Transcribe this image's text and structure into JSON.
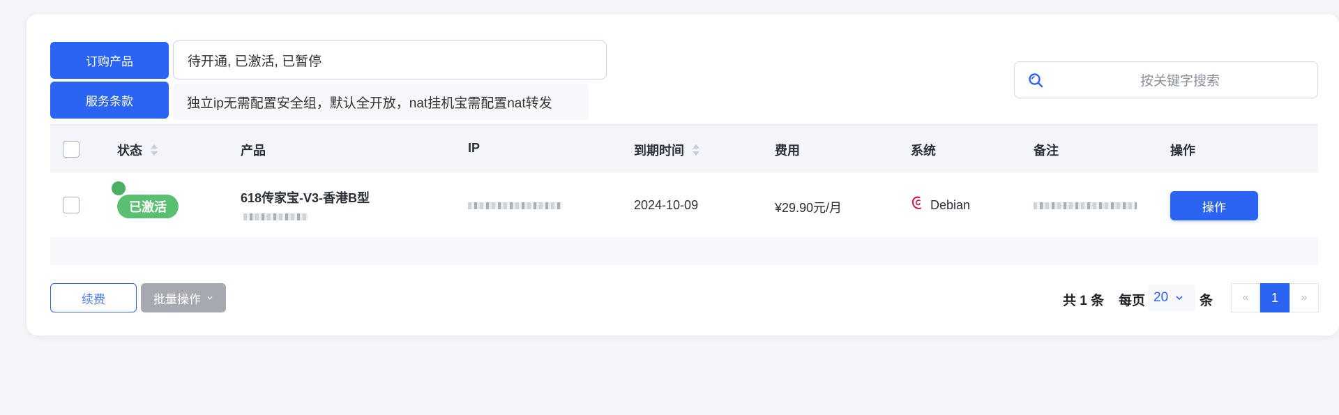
{
  "toolbar": {
    "order_label": "订购产品",
    "terms_label": "服务条款",
    "status_filter_value": "待开通, 已激活, 已暂停",
    "notice": "独立ip无需配置安全组，默认全开放，nat挂机宝需配置nat转发",
    "search_placeholder": "按关键字搜索"
  },
  "table": {
    "columns": [
      "状态",
      "产品",
      "IP",
      "到期时间",
      "费用",
      "系统",
      "备注",
      "操作"
    ],
    "rows": [
      {
        "status": "已激活",
        "product": "618传家宝-V3-香港B型",
        "expiry": "2024-10-09",
        "fee": "¥29.90元/月",
        "os": "Debian",
        "action": "操作"
      }
    ]
  },
  "footer": {
    "renew_label": "续费",
    "batch_label": "批量操作",
    "total_text": "共 1 条",
    "per_page_prefix": "每页",
    "per_page_value": "20",
    "per_page_suffix": "条",
    "prev": "«",
    "current_page": "1",
    "next": "»"
  },
  "colors": {
    "primary": "#2b63f2",
    "status_active": "#5bbf72"
  },
  "icons": [
    "search-icon",
    "sort-icon",
    "debian-logo-icon",
    "chevron-down-icon"
  ]
}
